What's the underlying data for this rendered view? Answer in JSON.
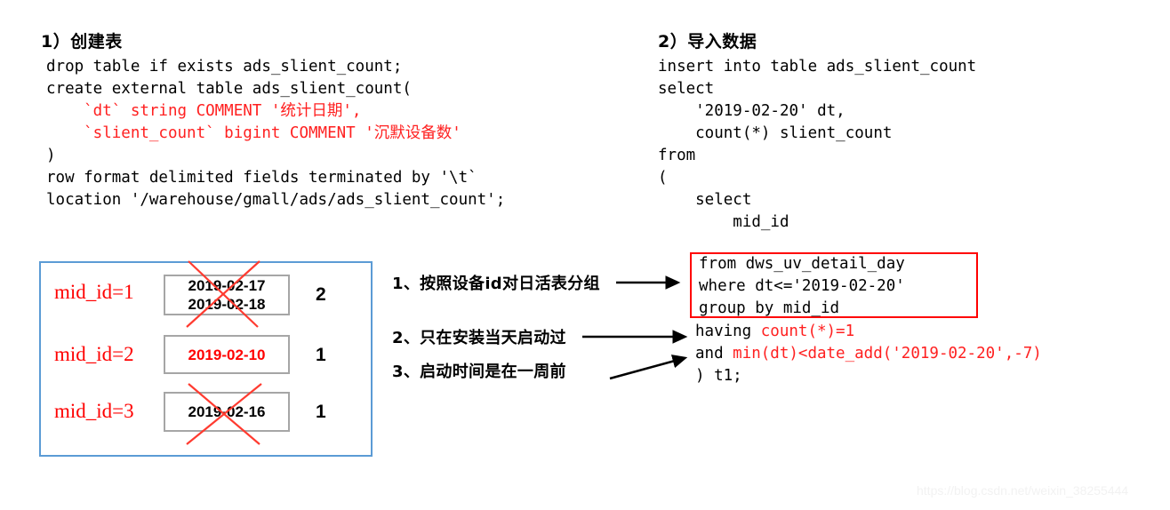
{
  "left_section": {
    "title": "1）创建表",
    "code_lines": [
      [
        {
          "t": "drop table if exists ads_slient_count;",
          "c": "black"
        }
      ],
      [
        {
          "t": "create external table ads_slient_count(",
          "c": "black"
        }
      ],
      [
        {
          "t": "    `dt` string COMMENT '统计日期',",
          "c": "red"
        }
      ],
      [
        {
          "t": "    `slient_count` bigint COMMENT '沉默设备数'",
          "c": "red"
        }
      ],
      [
        {
          "t": ")",
          "c": "black"
        }
      ],
      [
        {
          "t": "row format delimited fields terminated by '\\t`",
          "c": "black"
        }
      ],
      [
        {
          "t": "location '/warehouse/gmall/ads/ads_slient_count';",
          "c": "black"
        }
      ]
    ]
  },
  "right_section": {
    "title": "2）导入数据",
    "code_lines": [
      [
        {
          "t": "insert into table ads_slient_count",
          "c": "black"
        }
      ],
      [
        {
          "t": "select",
          "c": "black"
        }
      ],
      [
        {
          "t": "    '2019-02-20' dt,",
          "c": "black"
        }
      ],
      [
        {
          "t": "    count(*) slient_count",
          "c": "black"
        }
      ],
      [
        {
          "t": "from",
          "c": "black"
        }
      ],
      [
        {
          "t": "(",
          "c": "black"
        }
      ],
      [
        {
          "t": "    select",
          "c": "black"
        }
      ],
      [
        {
          "t": "        mid_id",
          "c": "black"
        }
      ]
    ],
    "boxed_lines": [
      [
        {
          "t": "from dws_uv_detail_day",
          "c": "black"
        }
      ],
      [
        {
          "t": "where dt<='2019-02-20'",
          "c": "black"
        }
      ],
      [
        {
          "t": "group by mid_id",
          "c": "black"
        }
      ]
    ],
    "tail_lines": [
      [
        {
          "t": "having ",
          "c": "black"
        },
        {
          "t": "count(*)=1",
          "c": "red"
        }
      ],
      [
        {
          "t": "and ",
          "c": "black"
        },
        {
          "t": "min(dt)<date_add('2019-02-20',-7)",
          "c": "red"
        }
      ],
      [
        {
          "t": ") t1;",
          "c": "black"
        }
      ]
    ]
  },
  "diagram": {
    "rows": [
      {
        "label": "mid_id=1",
        "dates": [
          "2019-02-17",
          "2019-02-18"
        ],
        "dates_color": "black",
        "count": "2",
        "crossed_out": true
      },
      {
        "label": "mid_id=2",
        "dates": [
          "2019-02-10"
        ],
        "dates_color": "red",
        "count": "1",
        "crossed_out": false
      },
      {
        "label": "mid_id=3",
        "dates": [
          "2019-02-16"
        ],
        "dates_color": "black",
        "count": "1",
        "crossed_out": true
      }
    ]
  },
  "notes": [
    {
      "text": "1、按照设备id对日活表分组"
    },
    {
      "text": "2、只在安装当天启动过"
    },
    {
      "text": "3、启动时间是在一周前"
    }
  ],
  "watermark": {
    "text": "https://blog.csdn.net/weixin_38255444"
  },
  "colors": {
    "accent_red": "#ff0000",
    "code_red": "#ff2020",
    "panel_blue": "#5b9bd5",
    "box_gray": "#a6a6a6"
  }
}
